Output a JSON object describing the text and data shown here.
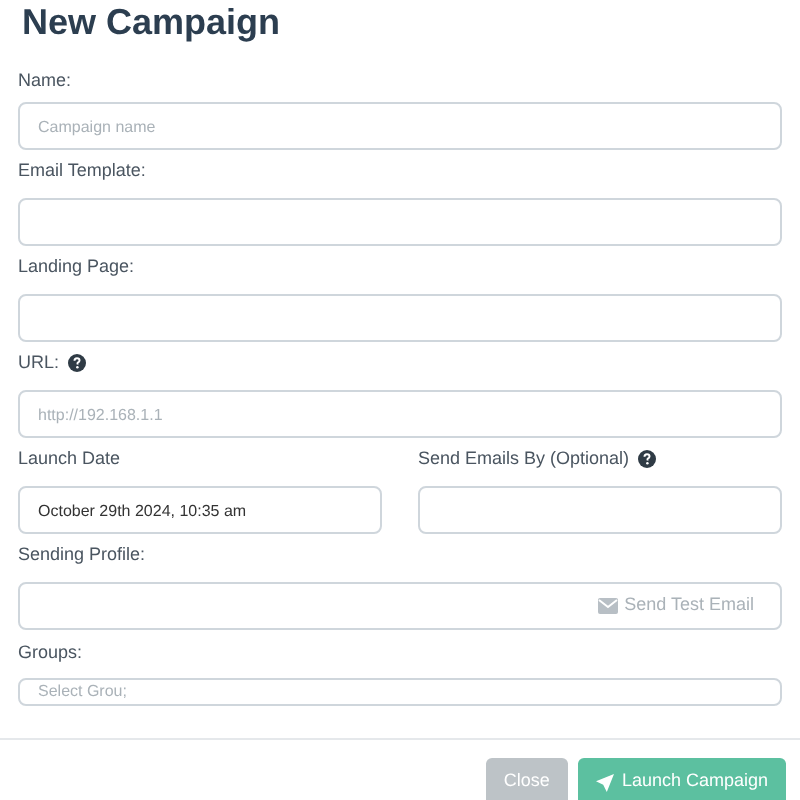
{
  "title": "New Campaign",
  "fields": [
    {
      "label": "Name:",
      "placeholder": "Campaign name"
    },
    {
      "label": "Email Template:"
    },
    {
      "label": "Landing Page:"
    },
    {
      "label": "URL:",
      "help": true,
      "placeholder": "http://192.168.1.1"
    }
  ],
  "date_row": [
    {
      "label": "Launch Date",
      "value": "October 29th 2024, 10:35 am"
    },
    {
      "label": "Send Emails By (Optional)",
      "help": true
    }
  ],
  "sending_profile": {
    "label": "Sending Profile:",
    "button": "Send Test Email"
  },
  "groups": {
    "label": "Groups:",
    "placeholder": "Select Grou;"
  },
  "buttons": [
    {
      "label": "Close",
      "kind": "secondary"
    },
    {
      "label": "Launch Campaign",
      "kind": "primary"
    }
  ]
}
